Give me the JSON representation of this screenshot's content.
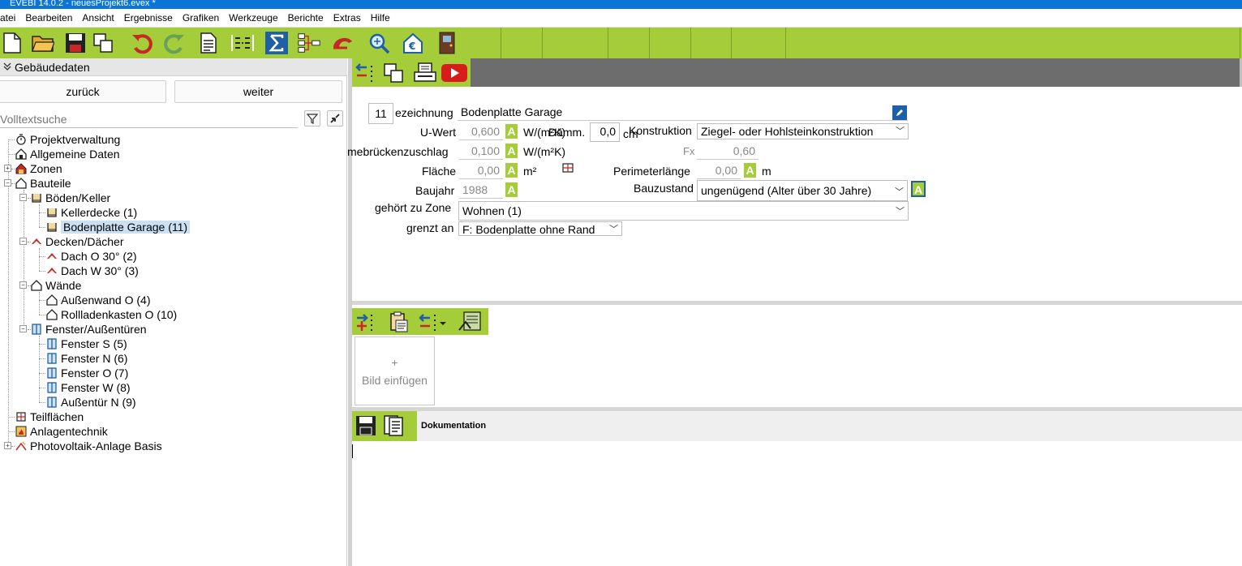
{
  "window": {
    "title": "EVEBI 14.0.2 - neuesProjekt6.evex *"
  },
  "menu": [
    "atei",
    "Bearbeiten",
    "Ansicht",
    "Ergebnisse",
    "Grafiken",
    "Werkzeuge",
    "Berichte",
    "Extras",
    "Hilfe"
  ],
  "toolbar_icons": [
    "new-document-icon",
    "open-folder-icon",
    "save-icon",
    "copy-icon",
    "undo-icon",
    "redo-icon",
    "report-icon",
    "compare-icon",
    "sum-icon",
    "network-icon",
    "cap-icon",
    "search-zoom-icon",
    "euro-house-icon",
    "door-icon"
  ],
  "sidebar": {
    "header": "Gebäudedaten",
    "back_label": "zurück",
    "next_label": "weiter",
    "search_placeholder": "Volltextsuche",
    "tree": {
      "projektverwaltung": "Projektverwaltung",
      "allgemeine": "Allgemeine Daten",
      "zonen": "Zonen",
      "bauteile": "Bauteile",
      "boeden": "Böden/Keller",
      "kellerdecke": "Kellerdecke (1)",
      "bodenplatte": "Bodenplatte Garage (11)",
      "decken": "Decken/Dächer",
      "dach_o": "Dach O 30° (2)",
      "dach_w": "Dach W 30° (3)",
      "waende": "Wände",
      "aussenwand": "Außenwand O (4)",
      "rollladen": "Rollladenkasten O (10)",
      "fenster": "Fenster/Außentüren",
      "fenster_s": "Fenster S (5)",
      "fenster_n": "Fenster N (6)",
      "fenster_o": "Fenster O (7)",
      "fenster_w": "Fenster W (8)",
      "aussentuer": "Außentür N (9)",
      "teilflaechen": "Teilflächen",
      "anlagentechnik": "Anlagentechnik",
      "photovoltaik": "Photovoltaik-Anlage Basis"
    }
  },
  "form": {
    "number": "11",
    "bezeichnung_label": "ezeichnung",
    "bezeichnung_value": "Bodenplatte Garage",
    "uwert_label": "U-Wert",
    "uwert_value": "0,600",
    "uwert_unit": "W/(m²K)",
    "daemm_label": "Dämm.",
    "daemm_value": "0,0",
    "daemm_unit": "cm",
    "konstruktion_label": "Konstruktion",
    "konstruktion_value": "Ziegel- oder Hohlsteinkonstruktion",
    "waermebruecken_label": "mebrückenzuschlag",
    "waermebruecken_value": "0,100",
    "waermebruecken_unit": "W/(m²K)",
    "fx_label": "Fx",
    "fx_value": "0,60",
    "flaeche_label": "Fläche",
    "flaeche_value": "0,00",
    "flaeche_unit": "m²",
    "perimeter_label": "Perimeterlänge",
    "perimeter_value": "0,00",
    "perimeter_unit": "m",
    "baujahr_label": "Baujahr",
    "baujahr_value": "1988",
    "bauzustand_label": "Bauzustand",
    "bauzustand_value": "ungenügend (Alter über 30 Jahre)",
    "zone_label": "gehört zu Zone",
    "zone_value": "Wohnen (1)",
    "grenzt_label": "grenzt an",
    "grenzt_value": "F: Bodenplatte ohne Rand",
    "auto_label": "A"
  },
  "image": {
    "plus": "+",
    "label": "Bild einfügen"
  },
  "doc": {
    "title": "Dokumentation"
  },
  "colors": {
    "accent_green": "#a5cd39",
    "titlebar_blue": "#0a74d7",
    "selection": "#cce0f3"
  }
}
